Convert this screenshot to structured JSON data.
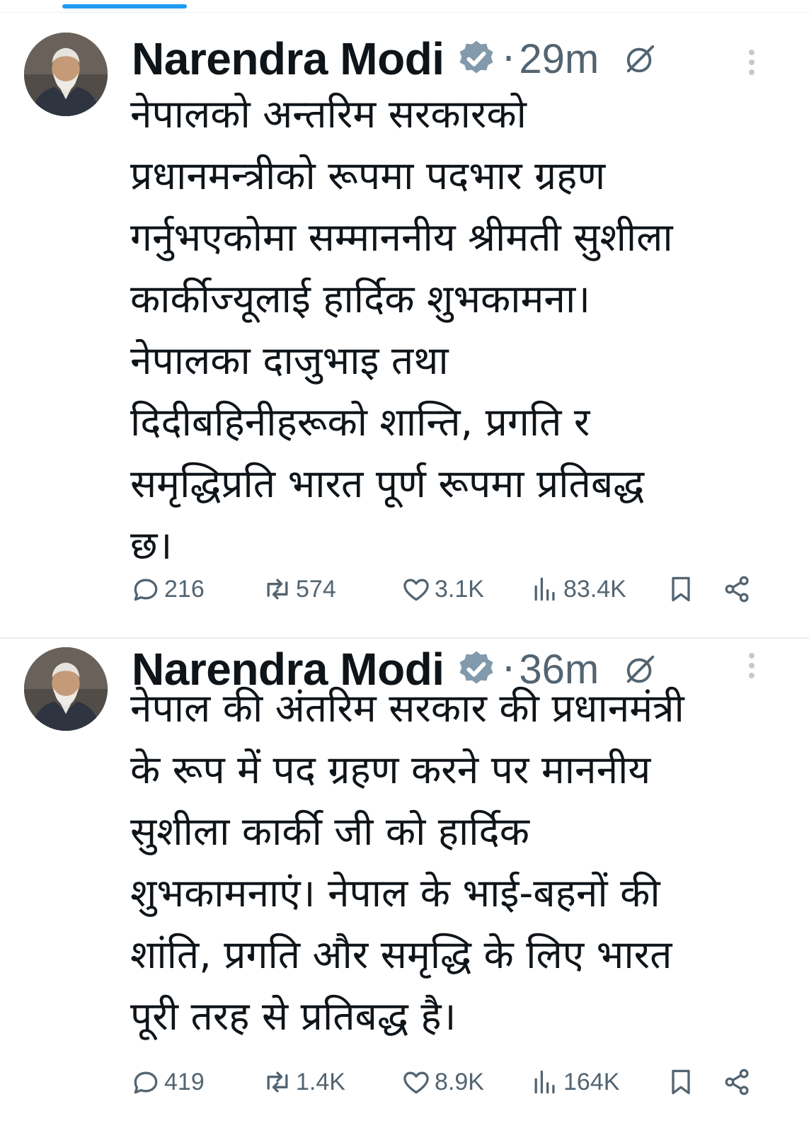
{
  "tweets": [
    {
      "author": "Narendra Modi",
      "time": "29m",
      "separator": "·",
      "text": "नेपालको अन्तरिम सरकारको\nप्रधानमन्त्रीको रूपमा पदभार ग्रहण\nगर्नुभएकोमा सम्माननीय श्रीमती सुशीला\nकार्कीज्यूलाई हार्दिक शुभकामना।\nनेपालका दाजुभाइ तथा\nदिदीबहिनीहरूको शान्ति, प्रगति र\nसमृद्धिप्रति भारत पूर्ण रूपमा प्रतिबद्ध\nछ।",
      "replies": "216",
      "reposts": "574",
      "likes": "3.1K",
      "views": "83.4K"
    },
    {
      "author": "Narendra Modi",
      "time": "36m",
      "separator": "·",
      "text": "नेपाल की अंतरिम सरकार की प्रधानमंत्री\nके रूप में पद ग्रहण करने पर माननीय\nसुशीला कार्की जी को हार्दिक\nशुभकामनाएं। नेपाल के भाई-बहनों की\nशांति, प्रगति और समृद्धि के लिए भारत\nपूरी तरह से प्रतिबद्ध है।",
      "replies": "419",
      "reposts": "1.4K",
      "likes": "8.9K",
      "views": "164K"
    }
  ],
  "icons": {
    "verified": "verified-badge-icon",
    "grok": "grok-icon",
    "more": "more-vertical-icon",
    "reply": "reply-icon",
    "repost": "repost-icon",
    "like": "heart-icon",
    "views": "views-icon",
    "bookmark": "bookmark-icon",
    "share": "share-icon"
  },
  "colors": {
    "accent": "#1d9bf0",
    "text": "#0f1419",
    "secondary": "#536471",
    "verified_badge": "#829aab"
  }
}
